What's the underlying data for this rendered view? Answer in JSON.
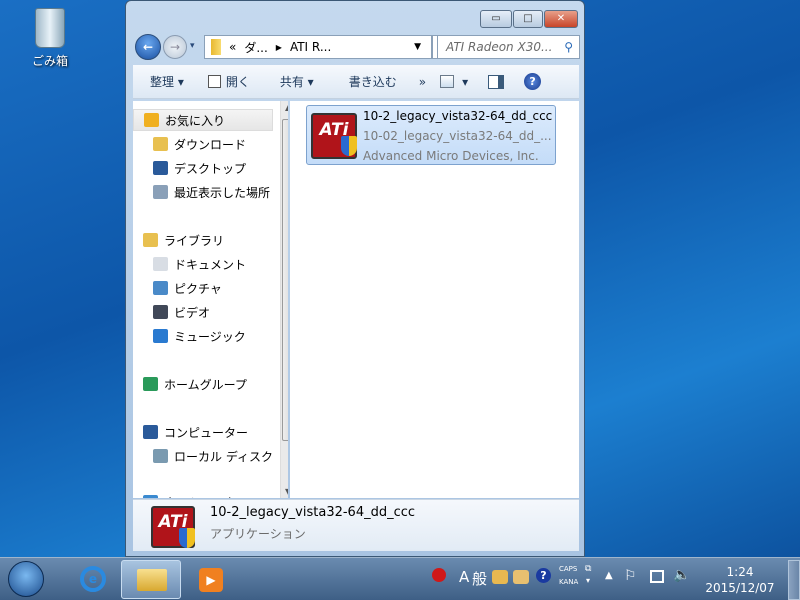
{
  "desktop": {
    "recycle_bin_label": "ごみ箱"
  },
  "window": {
    "controls": {
      "minimize": "▭",
      "maximize": "□",
      "close": "✕"
    },
    "address": {
      "breadcrumb": [
        "«",
        "ダ...",
        "ATI R..."
      ]
    },
    "search": {
      "placeholder": "ATI Radeon X30..."
    },
    "toolbar": {
      "organize": "整理 ▾",
      "open": "開く",
      "share": "共有 ▾",
      "burn": "書き込む",
      "more": "»",
      "views": "▾"
    },
    "nav": [
      {
        "label": "お気に入り",
        "icon": "star-icon",
        "selected": true
      },
      {
        "label": "ダウンロード",
        "icon": "downloads-folder-icon"
      },
      {
        "label": "デスクトップ",
        "icon": "desktop-icon"
      },
      {
        "label": "最近表示した場所",
        "icon": "recent-places-icon"
      },
      {
        "label": "ライブラリ",
        "icon": "library-icon"
      },
      {
        "label": "ドキュメント",
        "icon": "documents-icon"
      },
      {
        "label": "ピクチャ",
        "icon": "pictures-icon"
      },
      {
        "label": "ビデオ",
        "icon": "videos-icon"
      },
      {
        "label": "ミュージック",
        "icon": "music-icon"
      },
      {
        "label": "ホームグループ",
        "icon": "homegroup-icon"
      },
      {
        "label": "コンピューター",
        "icon": "computer-icon"
      },
      {
        "label": "ローカル ディスク",
        "icon": "local-disk-icon"
      },
      {
        "label": "ネットワーク",
        "icon": "network-icon"
      }
    ],
    "file": {
      "name": "10-2_legacy_vista32-64_dd_ccc",
      "description": "10-02_legacy_vista32-64_dd_...",
      "company": "Advanced Micro Devices, Inc.",
      "logo_text": "ATi"
    },
    "details": {
      "name": "10-2_legacy_vista32-64_dd_ccc",
      "type": "アプリケーション"
    }
  },
  "taskbar": {
    "ime_mode": "A",
    "ime_kanji": "般",
    "caps": "CAPS",
    "kana": "KANA",
    "time": "1:24",
    "date": "2015/12/07"
  }
}
